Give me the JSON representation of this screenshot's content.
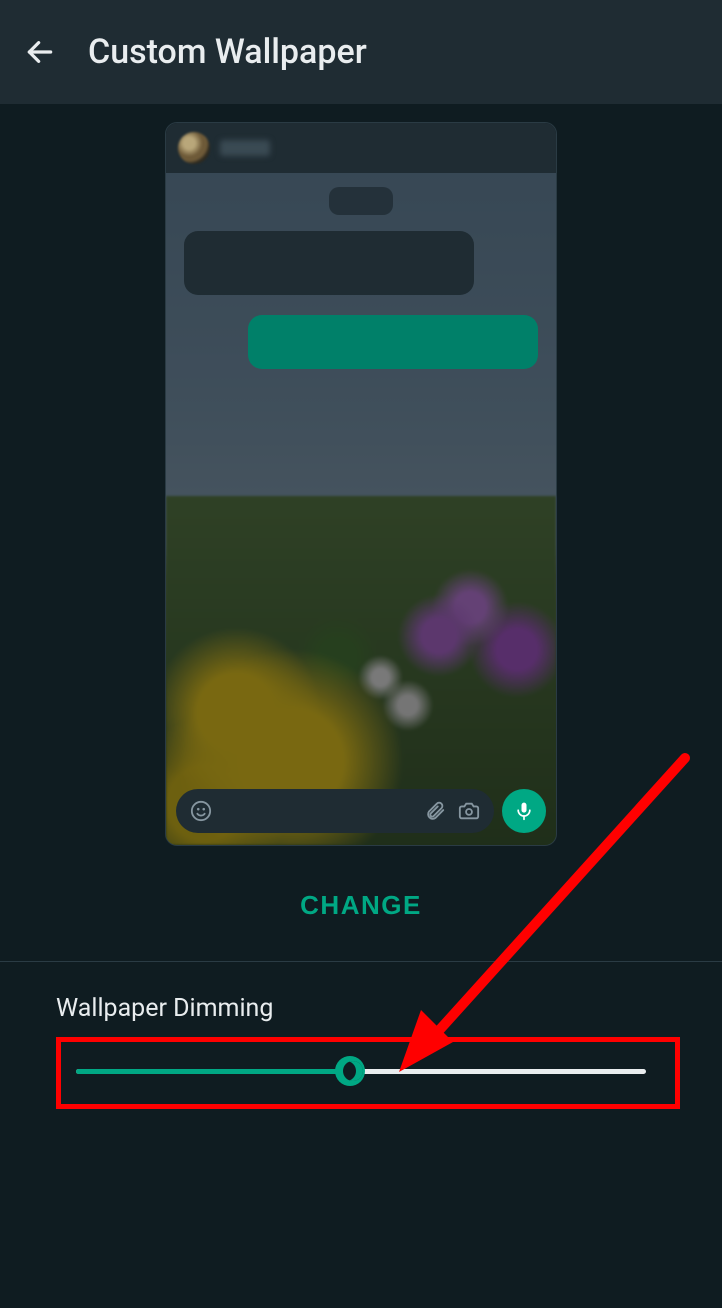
{
  "appbar": {
    "title": "Custom Wallpaper",
    "back_icon": "arrow-back"
  },
  "preview": {
    "input_icons": {
      "emoji": "emoji",
      "attach": "attachment",
      "camera": "camera",
      "mic": "mic"
    }
  },
  "actions": {
    "change_label": "CHANGE"
  },
  "dimming": {
    "label": "Wallpaper Dimming",
    "value_percent": 48
  },
  "colors": {
    "accent": "#00a884",
    "annotation": "#ff0000"
  }
}
